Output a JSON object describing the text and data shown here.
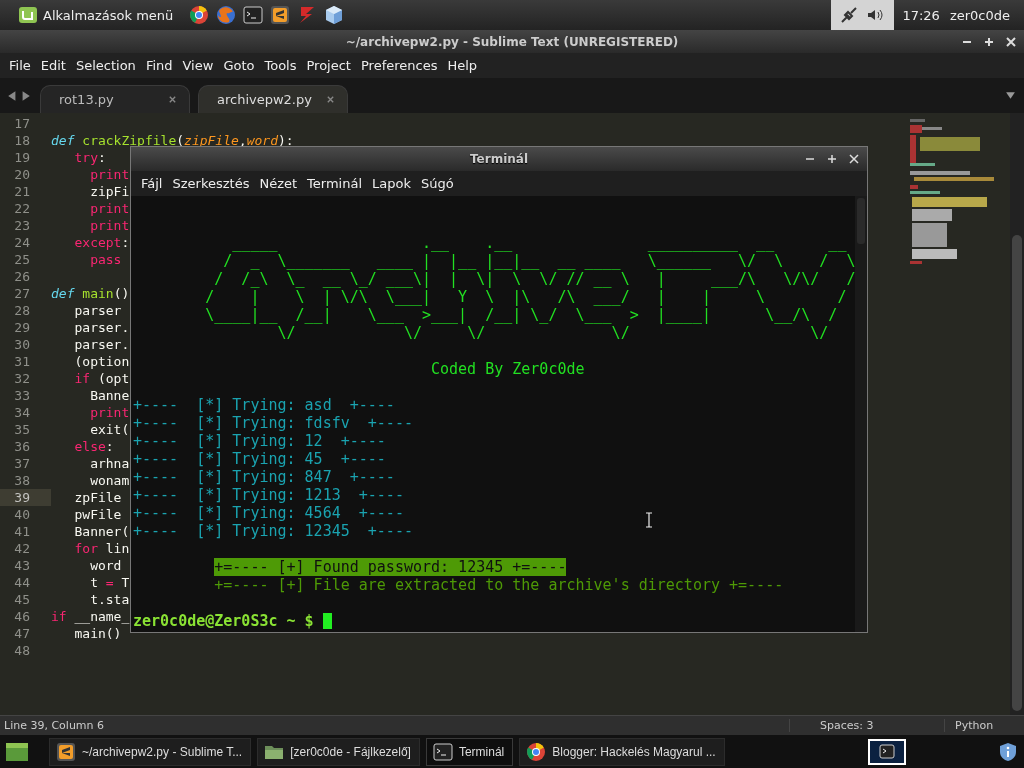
{
  "panel": {
    "menu": "Alkalmazások menü",
    "launchers": [
      {
        "kind": "ring"
      },
      {
        "kind": "globe"
      },
      {
        "kind": "terminal"
      },
      {
        "kind": "editor"
      },
      {
        "kind": "bolt"
      },
      {
        "kind": "cube"
      }
    ],
    "clock": "17:26",
    "user": "zer0c0de"
  },
  "editor_window": {
    "title": "~/archivepw2.py - Sublime Text (UNREGISTERED)",
    "menu": [
      "File",
      "Edit",
      "Selection",
      "Find",
      "View",
      "Goto",
      "Tools",
      "Project",
      "Preferences",
      "Help"
    ],
    "tabs": [
      {
        "label": "rot13.py",
        "selected": false
      },
      {
        "label": "archivepw2.py",
        "selected": true
      }
    ],
    "lines": [
      {
        "n": "17",
        "current": false
      },
      {
        "n": "18",
        "current": false,
        "tokens": [
          {
            "kind": "def",
            "text": "def"
          },
          {
            "kind": "fn",
            "text": " crackZipfile"
          },
          {
            "kind": "p",
            "text": "("
          },
          {
            "kind": "param",
            "text": "zipFile"
          },
          {
            "kind": "p",
            "text": ","
          },
          {
            "kind": "param",
            "text": "word"
          },
          {
            "kind": "p",
            "text": "):"
          }
        ]
      },
      {
        "n": "19",
        "current": false,
        "tokens": [
          {
            "kind": "kw",
            "text": "   try"
          },
          {
            "kind": "p",
            "text": ":"
          }
        ]
      },
      {
        "n": "20",
        "current": false,
        "tokens": [
          {
            "kind": "kw",
            "text": "     print"
          }
        ]
      },
      {
        "n": "21",
        "current": false,
        "tokens": [
          {
            "kind": "p",
            "text": "     zipFi"
          }
        ]
      },
      {
        "n": "22",
        "current": false,
        "tokens": [
          {
            "kind": "kw",
            "text": "     print"
          }
        ]
      },
      {
        "n": "23",
        "current": false,
        "tokens": [
          {
            "kind": "kw",
            "text": "     print"
          }
        ]
      },
      {
        "n": "24",
        "current": false,
        "tokens": [
          {
            "kind": "kw",
            "text": "   except"
          },
          {
            "kind": "p",
            "text": ":"
          }
        ]
      },
      {
        "n": "25",
        "current": false,
        "tokens": [
          {
            "kind": "kw",
            "text": "     pass"
          }
        ]
      },
      {
        "n": "26",
        "current": false
      },
      {
        "n": "27",
        "current": false,
        "tokens": [
          {
            "kind": "def",
            "text": "def"
          },
          {
            "kind": "fn",
            "text": " main"
          },
          {
            "kind": "p",
            "text": "()"
          }
        ]
      },
      {
        "n": "28",
        "current": false,
        "tokens": [
          {
            "kind": "p",
            "text": "   parser"
          }
        ]
      },
      {
        "n": "29",
        "current": false,
        "tokens": [
          {
            "kind": "p",
            "text": "   parser."
          }
        ]
      },
      {
        "n": "30",
        "current": false,
        "tokens": [
          {
            "kind": "p",
            "text": "   parser."
          }
        ]
      },
      {
        "n": "31",
        "current": false,
        "tokens": [
          {
            "kind": "p",
            "text": "   (option"
          }
        ]
      },
      {
        "n": "32",
        "current": false,
        "tokens": [
          {
            "kind": "kw",
            "text": "   if"
          },
          {
            "kind": "p",
            "text": " (opt"
          }
        ]
      },
      {
        "n": "33",
        "current": false,
        "tokens": [
          {
            "kind": "p",
            "text": "     Banne"
          }
        ]
      },
      {
        "n": "34",
        "current": false,
        "tokens": [
          {
            "kind": "kw",
            "text": "     print"
          }
        ]
      },
      {
        "n": "35",
        "current": false,
        "tokens": [
          {
            "kind": "p",
            "text": "     exit("
          }
        ]
      },
      {
        "n": "36",
        "current": false,
        "tokens": [
          {
            "kind": "kw",
            "text": "   else"
          },
          {
            "kind": "p",
            "text": ":"
          }
        ]
      },
      {
        "n": "37",
        "current": false,
        "tokens": [
          {
            "kind": "p",
            "text": "     arhna"
          }
        ]
      },
      {
        "n": "38",
        "current": false,
        "tokens": [
          {
            "kind": "p",
            "text": "     wonam"
          }
        ]
      },
      {
        "n": "39",
        "current": true,
        "tokens": [
          {
            "kind": "p",
            "text": "   zpFile"
          }
        ]
      },
      {
        "n": "40",
        "current": false,
        "tokens": [
          {
            "kind": "p",
            "text": "   pwFile"
          }
        ]
      },
      {
        "n": "41",
        "current": false,
        "tokens": [
          {
            "kind": "p",
            "text": "   Banner("
          }
        ]
      },
      {
        "n": "42",
        "current": false,
        "tokens": [
          {
            "kind": "kw",
            "text": "   for"
          },
          {
            "kind": "p",
            "text": " lin"
          }
        ]
      },
      {
        "n": "43",
        "current": false,
        "tokens": [
          {
            "kind": "p",
            "text": "     word"
          }
        ]
      },
      {
        "n": "44",
        "current": false,
        "tokens": [
          {
            "kind": "p",
            "text": "     t"
          },
          {
            "kind": "kw",
            "text": " ="
          },
          {
            "kind": "p",
            "text": " T"
          }
        ]
      },
      {
        "n": "45",
        "current": false,
        "tokens": [
          {
            "kind": "p",
            "text": "     t.sta"
          }
        ]
      },
      {
        "n": "46",
        "current": false,
        "tokens": [
          {
            "kind": "kw",
            "text": "if"
          },
          {
            "kind": "p",
            "text": " __name_"
          }
        ]
      },
      {
        "n": "47",
        "current": false,
        "tokens": [
          {
            "kind": "p",
            "text": "   main()"
          }
        ]
      },
      {
        "n": "48",
        "current": false
      }
    ],
    "status": {
      "position": "Line 39, Column 6",
      "indent": "Spaces: 3",
      "syntax": "Python"
    }
  },
  "terminal": {
    "title": "Terminál",
    "menu": [
      "Fájl",
      "Szerkesztés",
      "Nézet",
      "Terminál",
      "Lapok",
      "Súgó"
    ],
    "lines": [
      {
        "kind": "blank"
      },
      {
        "kind": "blank"
      },
      {
        "kind": "art",
        "text": "   _____                .__    .__               __________  __      __"
      },
      {
        "kind": "art",
        "text": "  /  _  \\_______   ____ |  |__ |__|__  __ ____   \\______   \\/  \\    /  \\"
      },
      {
        "kind": "art",
        "text": " /  /_\\  \\_  __ \\_/ ___\\|  |  \\|  \\  \\/ // __ \\   |     ___/\\   \\/\\/   /"
      },
      {
        "kind": "art",
        "text": "/    |    \\  | \\/\\  \\___|   Y  \\  |\\   /\\  ___/   |    |     \\        /"
      },
      {
        "kind": "art",
        "text": "\\____|__  /__|    \\___  >___|  /__| \\_/  \\___  >  |____|      \\__/\\  /"
      },
      {
        "kind": "art",
        "text": "        \\/            \\/     \\/              \\/                    \\/"
      },
      {
        "kind": "blank"
      },
      {
        "kind": "credit",
        "text": "Coded By Zer0c0de"
      },
      {
        "kind": "blank"
      },
      {
        "kind": "attempt",
        "text": "+----  [*] Trying: asd  +----"
      },
      {
        "kind": "attempt",
        "text": "+----  [*] Trying: fdsfv  +----"
      },
      {
        "kind": "attempt",
        "text": "+----  [*] Trying: 12  +----"
      },
      {
        "kind": "attempt",
        "text": "+----  [*] Trying: 45  +----"
      },
      {
        "kind": "attempt",
        "text": "+----  [*] Trying: 847  +----"
      },
      {
        "kind": "attempt",
        "text": "+----  [*] Trying: 1213  +----"
      },
      {
        "kind": "attempt",
        "text": "+----  [*] Trying: 4564  +----"
      },
      {
        "kind": "attempt",
        "text": "+----  [*] Trying: 12345  +----"
      },
      {
        "kind": "blank"
      },
      {
        "kind": "found",
        "text": "+=---- [+] Found password: 12345 +=----"
      },
      {
        "kind": "info",
        "text": "+=---- [+] File are extracted to the archive's directory +=----"
      },
      {
        "kind": "blank"
      },
      {
        "kind": "prompt",
        "text": "zer0c0de@Zer0S3c ~ $"
      }
    ]
  },
  "taskbar": {
    "tasks": [
      {
        "label": "~/archivepw2.py - Sublime T...",
        "kind": "editor",
        "selected": false
      },
      {
        "label": "[zer0c0de - Fájlkezelő]",
        "kind": "folder",
        "selected": false
      },
      {
        "label": "Terminál",
        "kind": "terminal",
        "selected": true
      },
      {
        "label": "Blogger: Hackelés Magyarul ...",
        "kind": "ring",
        "selected": false
      }
    ]
  }
}
